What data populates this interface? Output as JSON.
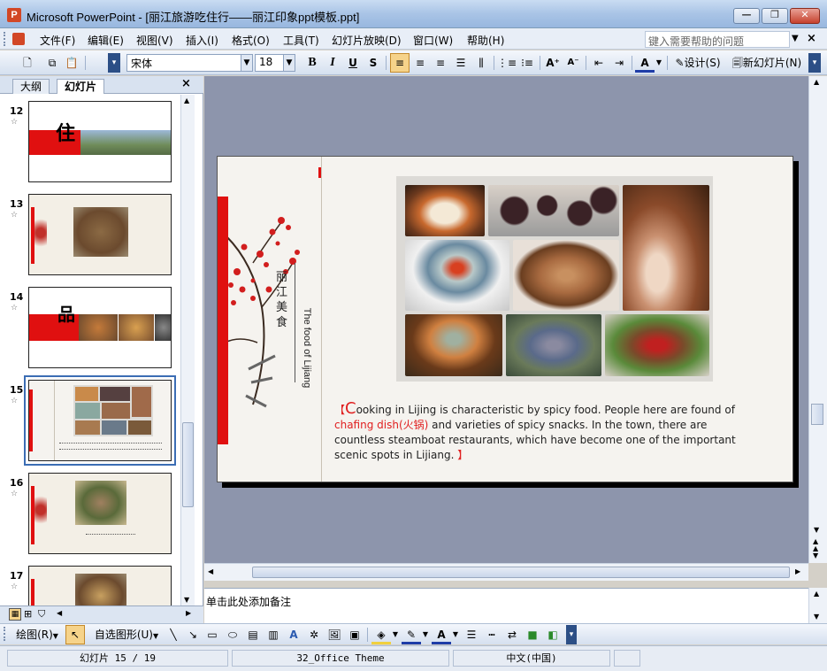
{
  "window": {
    "app_icon": "P",
    "title": "Microsoft PowerPoint - [丽江旅游吃住行——丽江印象ppt模板.ppt]",
    "min": "—",
    "max": "❐",
    "close": "✕"
  },
  "menu": {
    "items": [
      "文件(F)",
      "编辑(E)",
      "视图(V)",
      "插入(I)",
      "格式(O)",
      "工具(T)",
      "幻灯片放映(D)",
      "窗口(W)",
      "帮助(H)"
    ],
    "help_placeholder": "键入需要帮助的问题",
    "close": "×"
  },
  "format_toolbar": {
    "font_name": "宋体",
    "font_size": "18",
    "bold": "B",
    "italic": "I",
    "underline": "U",
    "shadow": "S",
    "design_label": "设计(S)",
    "new_slide_label": "新幻灯片(N)"
  },
  "left_pane": {
    "tabs": [
      "大纲",
      "幻灯片"
    ],
    "close": "×",
    "slides": [
      {
        "num": "12",
        "title_char": "住"
      },
      {
        "num": "13",
        "title_char": ""
      },
      {
        "num": "14",
        "title_char": "品"
      },
      {
        "num": "15",
        "title_char": ""
      },
      {
        "num": "16",
        "title_char": ""
      },
      {
        "num": "17",
        "title_char": ""
      }
    ],
    "selected_slide": "15"
  },
  "slide": {
    "title_cn": "丽江美食",
    "title_en": "The food of Lijiang",
    "caption": {
      "open_bracket": "【",
      "first_letter": "C",
      "text1": "ooking in Lijing is characteristic by spicy food. People here are found of ",
      "red_text": "chafing dish(火锅)",
      "text2": " and varieties of spicy snacks. In the town, there are countless steamboat restaurants, which have become one of the important scenic spots in Lijiang. ",
      "close_bracket": "】"
    }
  },
  "notes": {
    "placeholder": "单击此处添加备注"
  },
  "draw_toolbar": {
    "draw_label": "绘图(R)",
    "autoshape_label": "自选图形(U)"
  },
  "status": {
    "slide_pos": "幻灯片 15 / 19",
    "theme": "32_Office Theme",
    "language": "中文(中国)"
  },
  "colors": {
    "accent_red": "#e01010",
    "selection_blue": "#3b6db4"
  }
}
